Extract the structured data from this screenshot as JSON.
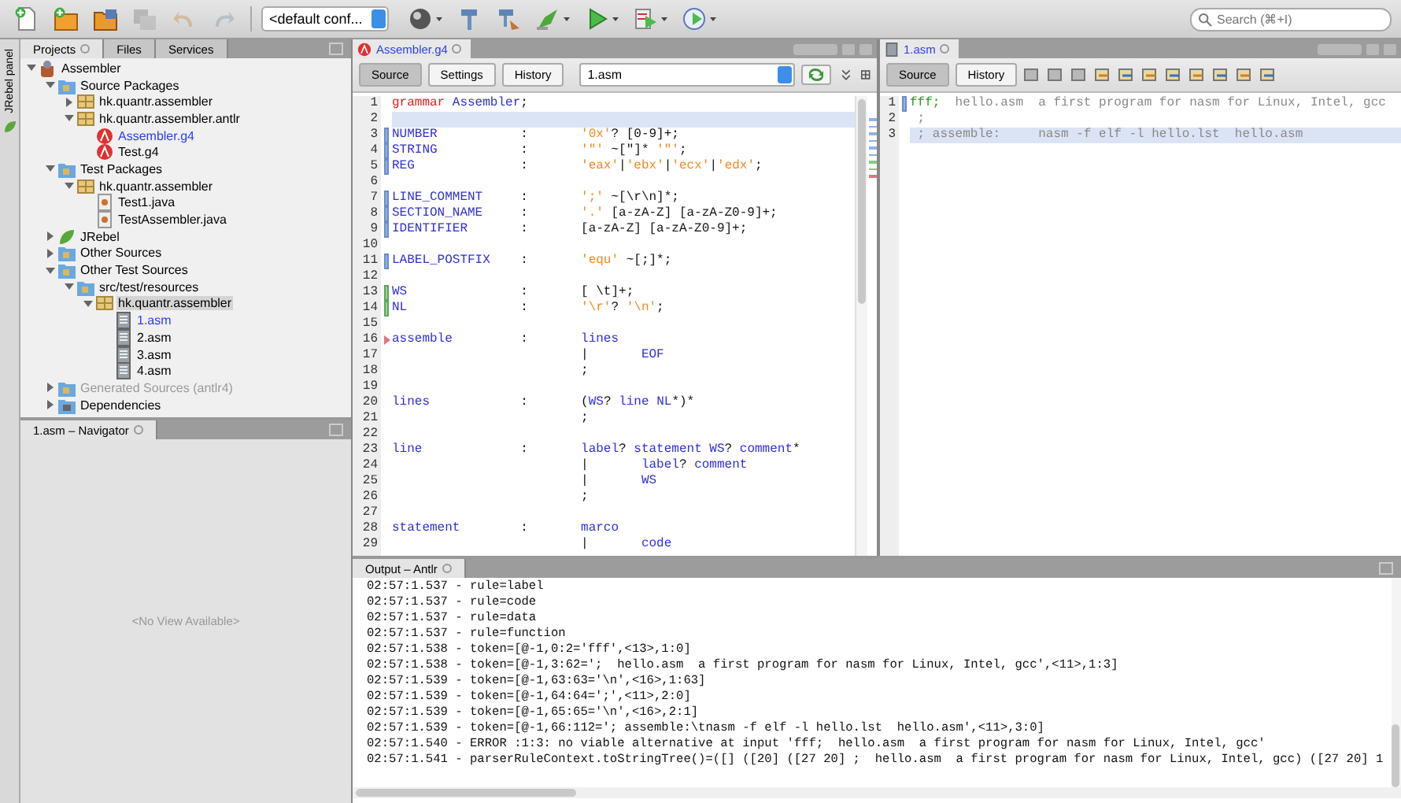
{
  "toolbar": {
    "buttons_left": [
      {
        "kind": "new-file",
        "disabled": false,
        "menu": false
      },
      {
        "kind": "new-project",
        "disabled": false,
        "menu": false
      },
      {
        "kind": "open-project",
        "disabled": false,
        "menu": false
      },
      {
        "kind": "save-all",
        "disabled": true,
        "menu": false
      },
      {
        "kind": "undo",
        "disabled": true,
        "menu": false
      },
      {
        "kind": "redo",
        "disabled": true,
        "menu": false
      }
    ],
    "config": "<default conf...",
    "buttons_right": [
      {
        "kind": "sphere",
        "disabled": false,
        "menu": true
      },
      {
        "kind": "hammer",
        "disabled": false,
        "menu": false
      },
      {
        "kind": "clean",
        "disabled": false,
        "menu": false
      },
      {
        "kind": "deploy",
        "disabled": false,
        "menu": true
      },
      {
        "kind": "run",
        "disabled": false,
        "menu": true
      },
      {
        "kind": "debug",
        "disabled": false,
        "menu": true
      },
      {
        "kind": "profile",
        "disabled": false,
        "menu": true
      }
    ],
    "search_placeholder": "Search (⌘+I)"
  },
  "side_strip": {
    "label": "JRebel panel"
  },
  "projects": {
    "tabs": [
      {
        "label": "Projects",
        "selected": true
      },
      {
        "label": "Files",
        "selected": false
      },
      {
        "label": "Services",
        "selected": false
      }
    ],
    "tree": [
      {
        "label": "Assembler",
        "kind": "project",
        "expanded": true,
        "selected": false,
        "open": false,
        "disabled": false,
        "children": [
          {
            "label": "Source Packages",
            "kind": "source-root",
            "expanded": true,
            "selected": false,
            "open": false,
            "disabled": false,
            "children": [
              {
                "label": "hk.quantr.assembler",
                "kind": "package",
                "expanded": false,
                "selected": false,
                "open": false,
                "disabled": false
              },
              {
                "label": "hk.quantr.assembler.antlr",
                "kind": "package",
                "expanded": true,
                "selected": false,
                "open": false,
                "disabled": false,
                "children": [
                  {
                    "label": "Assembler.g4",
                    "kind": "grammar",
                    "selected": false,
                    "open": true,
                    "disabled": false
                  },
                  {
                    "label": "Test.g4",
                    "kind": "grammar",
                    "selected": false,
                    "open": false,
                    "disabled": false
                  }
                ]
              }
            ]
          },
          {
            "label": "Test Packages",
            "kind": "source-root",
            "expanded": true,
            "selected": false,
            "open": false,
            "disabled": false,
            "children": [
              {
                "label": "hk.quantr.assembler",
                "kind": "package",
                "expanded": true,
                "selected": false,
                "open": false,
                "disabled": false,
                "children": [
                  {
                    "label": "Test1.java",
                    "kind": "java",
                    "selected": false,
                    "open": false,
                    "disabled": false
                  },
                  {
                    "label": "TestAssembler.java",
                    "kind": "java",
                    "selected": false,
                    "open": false,
                    "disabled": false
                  }
                ]
              }
            ]
          },
          {
            "label": "JRebel",
            "kind": "jrebel",
            "expanded": false,
            "selected": false,
            "open": false,
            "disabled": false
          },
          {
            "label": "Other Sources",
            "kind": "source-root",
            "expanded": false,
            "selected": false,
            "open": false,
            "disabled": false
          },
          {
            "label": "Other Test Sources",
            "kind": "source-root",
            "expanded": true,
            "selected": false,
            "open": false,
            "disabled": false,
            "children": [
              {
                "label": "src/test/resources",
                "kind": "source-root",
                "expanded": true,
                "selected": false,
                "open": false,
                "disabled": false,
                "children": [
                  {
                    "label": "hk.quantr.assembler",
                    "kind": "package",
                    "expanded": true,
                    "selected": true,
                    "open": false,
                    "disabled": false,
                    "children": [
                      {
                        "label": "1.asm",
                        "kind": "asm",
                        "selected": false,
                        "open": true,
                        "disabled": false
                      },
                      {
                        "label": "2.asm",
                        "kind": "asm",
                        "selected": false,
                        "open": false,
                        "disabled": false
                      },
                      {
                        "label": "3.asm",
                        "kind": "asm",
                        "selected": false,
                        "open": false,
                        "disabled": false
                      },
                      {
                        "label": "4.asm",
                        "kind": "asm",
                        "selected": false,
                        "open": false,
                        "disabled": false
                      }
                    ]
                  }
                ]
              }
            ]
          },
          {
            "label": "Generated Sources (antlr4)",
            "kind": "source-root",
            "expanded": false,
            "selected": false,
            "open": false,
            "disabled": true
          },
          {
            "label": "Dependencies",
            "kind": "library",
            "expanded": false,
            "selected": false,
            "open": false,
            "disabled": false
          }
        ]
      }
    ]
  },
  "navigator": {
    "tab": "1.asm – Navigator",
    "message": "<No View Available>"
  },
  "grammar_editor": {
    "tab": "Assembler.g4",
    "buttons": [
      {
        "label": "Source",
        "selected": true
      },
      {
        "label": "Settings",
        "selected": false
      },
      {
        "label": "History",
        "selected": false
      }
    ],
    "input_file": "1.asm",
    "lines": [
      {
        "num": "1",
        "kind": "plain",
        "current": false,
        "tokens": [
          {
            "kind": "keyword",
            "text": "grammar "
          },
          {
            "kind": "rule",
            "text": "Assembler"
          },
          {
            "kind": "plain",
            "text": ";"
          }
        ]
      },
      {
        "num": "2",
        "kind": "plain",
        "current": true
      },
      {
        "num": "3",
        "kind": "modified",
        "current": false,
        "tokens": [
          {
            "kind": "rule",
            "text": "NUMBER"
          },
          {
            "kind": "plain",
            "text": "           :       "
          },
          {
            "kind": "literal",
            "text": "'0x'"
          },
          {
            "kind": "plain",
            "text": "? [0-9]+;"
          }
        ]
      },
      {
        "num": "4",
        "kind": "modified",
        "current": false,
        "tokens": [
          {
            "kind": "rule",
            "text": "STRING"
          },
          {
            "kind": "plain",
            "text": "           :       "
          },
          {
            "kind": "literal",
            "text": "'\"'"
          },
          {
            "kind": "plain",
            "text": " ~[\"]* "
          },
          {
            "kind": "literal",
            "text": "'\"'"
          },
          {
            "kind": "plain",
            "text": ";"
          }
        ]
      },
      {
        "num": "5",
        "kind": "modified",
        "current": false,
        "tokens": [
          {
            "kind": "rule",
            "text": "REG"
          },
          {
            "kind": "plain",
            "text": "              :       "
          },
          {
            "kind": "literal",
            "text": "'eax'"
          },
          {
            "kind": "plain",
            "text": "|"
          },
          {
            "kind": "literal",
            "text": "'ebx'"
          },
          {
            "kind": "plain",
            "text": "|"
          },
          {
            "kind": "literal",
            "text": "'ecx'"
          },
          {
            "kind": "plain",
            "text": "|"
          },
          {
            "kind": "literal",
            "text": "'edx'"
          },
          {
            "kind": "plain",
            "text": ";"
          }
        ]
      },
      {
        "num": "6",
        "kind": "plain",
        "current": false
      },
      {
        "num": "7",
        "kind": "modified",
        "current": false,
        "tokens": [
          {
            "kind": "rule",
            "text": "LINE_COMMENT"
          },
          {
            "kind": "plain",
            "text": "     :       "
          },
          {
            "kind": "literal",
            "text": "';'"
          },
          {
            "kind": "plain",
            "text": " ~[\\r\\n]*;"
          }
        ]
      },
      {
        "num": "8",
        "kind": "modified",
        "current": false,
        "tokens": [
          {
            "kind": "rule",
            "text": "SECTION_NAME"
          },
          {
            "kind": "plain",
            "text": "     :       "
          },
          {
            "kind": "literal",
            "text": "'.'"
          },
          {
            "kind": "plain",
            "text": " [a-zA-Z] [a-zA-Z0-9]+;"
          }
        ]
      },
      {
        "num": "9",
        "kind": "modified",
        "current": false,
        "tokens": [
          {
            "kind": "rule",
            "text": "IDENTIFIER"
          },
          {
            "kind": "plain",
            "text": "       :       [a-zA-Z] [a-zA-Z0-9]+;"
          }
        ]
      },
      {
        "num": "10",
        "kind": "plain",
        "current": false
      },
      {
        "num": "11",
        "kind": "modified",
        "current": false,
        "tokens": [
          {
            "kind": "rule",
            "text": "LABEL_POSTFIX"
          },
          {
            "kind": "plain",
            "text": "    :       "
          },
          {
            "kind": "literal",
            "text": "'equ'"
          },
          {
            "kind": "plain",
            "text": " ~[;]*;"
          }
        ]
      },
      {
        "num": "12",
        "kind": "plain",
        "current": false
      },
      {
        "num": "13",
        "kind": "added",
        "current": false,
        "tokens": [
          {
            "kind": "rule",
            "text": "WS"
          },
          {
            "kind": "plain",
            "text": "               :       [ \\t]+;"
          }
        ]
      },
      {
        "num": "14",
        "kind": "added",
        "current": false,
        "tokens": [
          {
            "kind": "rule",
            "text": "NL"
          },
          {
            "kind": "plain",
            "text": "               :       "
          },
          {
            "kind": "literal",
            "text": "'\\r'"
          },
          {
            "kind": "plain",
            "text": "? "
          },
          {
            "kind": "literal",
            "text": "'\\n'"
          },
          {
            "kind": "plain",
            "text": ";"
          }
        ]
      },
      {
        "num": "15",
        "kind": "plain",
        "current": false
      },
      {
        "num": "16",
        "kind": "error",
        "current": false,
        "tokens": [
          {
            "kind": "rule",
            "text": "assemble"
          },
          {
            "kind": "plain",
            "text": "         :       "
          },
          {
            "kind": "rule",
            "text": "lines"
          }
        ]
      },
      {
        "num": "17",
        "kind": "plain",
        "current": false,
        "tokens": [
          {
            "kind": "plain",
            "text": "                         |       "
          },
          {
            "kind": "rule",
            "text": "EOF"
          }
        ]
      },
      {
        "num": "18",
        "kind": "plain",
        "current": false,
        "tokens": [
          {
            "kind": "plain",
            "text": "                         ;"
          }
        ]
      },
      {
        "num": "19",
        "kind": "plain",
        "current": false
      },
      {
        "num": "20",
        "kind": "plain",
        "current": false,
        "tokens": [
          {
            "kind": "rule",
            "text": "lines"
          },
          {
            "kind": "plain",
            "text": "            :       ("
          },
          {
            "kind": "rule",
            "text": "WS"
          },
          {
            "kind": "plain",
            "text": "? "
          },
          {
            "kind": "rule",
            "text": "line "
          },
          {
            "kind": "rule",
            "text": "NL"
          },
          {
            "kind": "plain",
            "text": "*)*"
          }
        ]
      },
      {
        "num": "21",
        "kind": "plain",
        "current": false,
        "tokens": [
          {
            "kind": "plain",
            "text": "                         ;"
          }
        ]
      },
      {
        "num": "22",
        "kind": "plain",
        "current": false
      },
      {
        "num": "23",
        "kind": "plain",
        "current": false,
        "tokens": [
          {
            "kind": "rule",
            "text": "line"
          },
          {
            "kind": "plain",
            "text": "             :       "
          },
          {
            "kind": "rule",
            "text": "label"
          },
          {
            "kind": "plain",
            "text": "? "
          },
          {
            "kind": "rule",
            "text": "statement "
          },
          {
            "kind": "rule",
            "text": "WS"
          },
          {
            "kind": "plain",
            "text": "? "
          },
          {
            "kind": "rule",
            "text": "comment"
          },
          {
            "kind": "plain",
            "text": "*"
          }
        ]
      },
      {
        "num": "24",
        "kind": "plain",
        "current": false,
        "tokens": [
          {
            "kind": "plain",
            "text": "                         |       "
          },
          {
            "kind": "rule",
            "text": "label"
          },
          {
            "kind": "plain",
            "text": "? "
          },
          {
            "kind": "rule",
            "text": "comment"
          }
        ]
      },
      {
        "num": "25",
        "kind": "plain",
        "current": false,
        "tokens": [
          {
            "kind": "plain",
            "text": "                         |       "
          },
          {
            "kind": "rule",
            "text": "WS"
          }
        ]
      },
      {
        "num": "26",
        "kind": "plain",
        "current": false,
        "tokens": [
          {
            "kind": "plain",
            "text": "                         ;"
          }
        ]
      },
      {
        "num": "27",
        "kind": "plain",
        "current": false
      },
      {
        "num": "28",
        "kind": "plain",
        "current": false,
        "tokens": [
          {
            "kind": "rule",
            "text": "statement"
          },
          {
            "kind": "plain",
            "text": "        :       "
          },
          {
            "kind": "rule",
            "text": "marco"
          }
        ]
      },
      {
        "num": "29",
        "kind": "plain",
        "current": false,
        "tokens": [
          {
            "kind": "plain",
            "text": "                         |       "
          },
          {
            "kind": "rule",
            "text": "code"
          }
        ]
      }
    ]
  },
  "asm_editor": {
    "tab": "1.asm",
    "buttons": [
      {
        "label": "Source",
        "selected": true
      },
      {
        "label": "History",
        "selected": false
      }
    ],
    "lines": [
      {
        "num": "1",
        "kind": "modified",
        "current": false,
        "tokens": [
          {
            "kind": "label",
            "text": "fff;"
          },
          {
            "kind": "comment",
            "text": "  hello.asm  a first program for nasm for Linux, Intel, gcc"
          }
        ]
      },
      {
        "num": "2",
        "kind": "plain",
        "current": false,
        "tokens": [
          {
            "kind": "comment",
            "text": " ;"
          }
        ]
      },
      {
        "num": "3",
        "kind": "plain",
        "current": true,
        "tokens": [
          {
            "kind": "comment",
            "text": " ; assemble:     nasm -f elf -l hello.lst  hello.asm"
          }
        ]
      }
    ]
  },
  "output": {
    "tab": "Output – Antlr",
    "lines": [
      "02:57:1.537 - rule=label",
      "02:57:1.537 - rule=code",
      "02:57:1.537 - rule=data",
      "02:57:1.537 - rule=function",
      "02:57:1.538 - token=[@-1,0:2='fff',<13>,1:0]",
      "02:57:1.538 - token=[@-1,3:62=';  hello.asm  a first program for nasm for Linux, Intel, gcc',<11>,1:3]",
      "02:57:1.539 - token=[@-1,63:63='\\n',<16>,1:63]",
      "02:57:1.539 - token=[@-1,64:64=';',<11>,2:0]",
      "02:57:1.539 - token=[@-1,65:65='\\n',<16>,2:1]",
      "02:57:1.539 - token=[@-1,66:112='; assemble:\\tnasm -f elf -l hello.lst  hello.asm',<11>,3:0]",
      "02:57:1.540 - ERROR :1:3: no viable alternative at input 'fff;  hello.asm  a first program for nasm for Linux, Intel, gcc'",
      "02:57:1.541 - parserRuleContext.toStringTree()=([] ([20] ([27 20] ;  hello.asm  a first program for nasm for Linux, Intel, gcc) ([27 20] 1"
    ]
  }
}
